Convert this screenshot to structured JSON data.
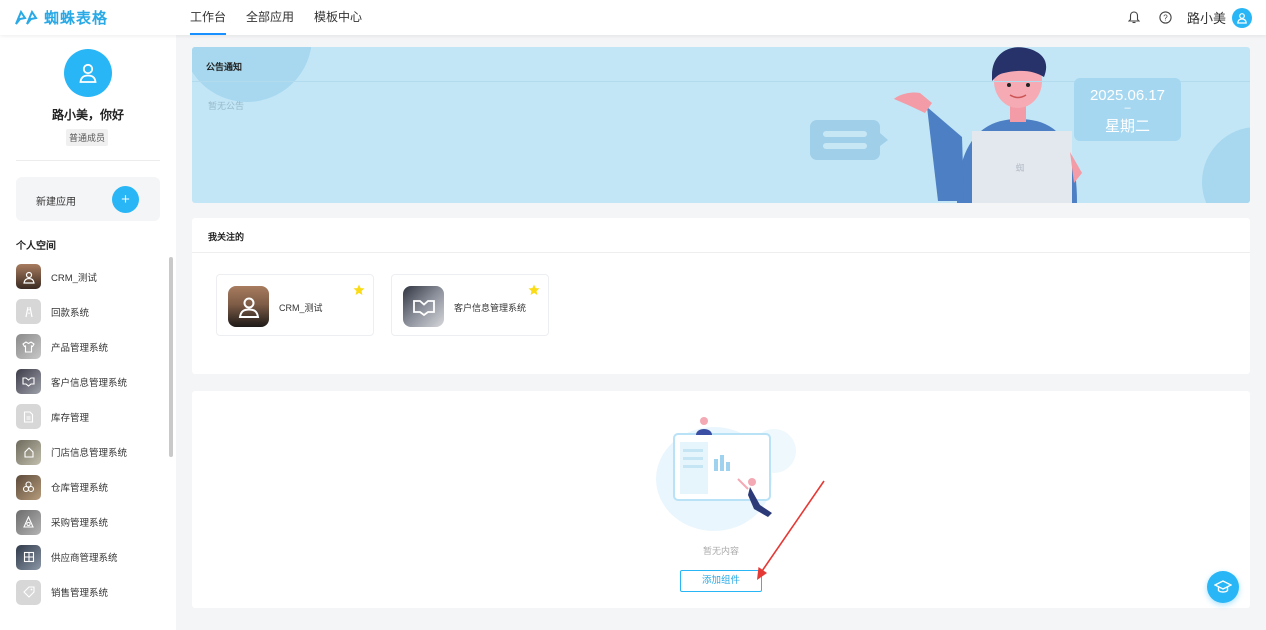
{
  "brand": {
    "name": "蜘蛛表格",
    "color": "#29a9e6"
  },
  "nav": {
    "items": [
      {
        "label": "工作台",
        "active": true
      },
      {
        "label": "全部应用",
        "active": false
      },
      {
        "label": "模板中心",
        "active": false
      }
    ]
  },
  "topbar": {
    "user_name": "路小美",
    "icons": [
      "bell-icon",
      "help-icon",
      "user-avatar-icon"
    ]
  },
  "sidebar": {
    "greeting": "路小美，你好",
    "role": "普通成员",
    "new_app_label": "新建应用",
    "new_app_button": "+",
    "section_title": "个人空间",
    "apps": [
      {
        "label": "CRM_测试"
      },
      {
        "label": "回款系统"
      },
      {
        "label": "产品管理系统"
      },
      {
        "label": "客户信息管理系统"
      },
      {
        "label": "库存管理"
      },
      {
        "label": "门店信息管理系统"
      },
      {
        "label": "仓库管理系统"
      },
      {
        "label": "采购管理系统"
      },
      {
        "label": "供应商管理系统"
      },
      {
        "label": "销售管理系统"
      }
    ]
  },
  "notice": {
    "title": "公告通知",
    "empty": "暂无公告",
    "date": "2025.06.17",
    "date_separator": "–",
    "weekday": "星期二"
  },
  "following": {
    "title": "我关注的",
    "items": [
      {
        "label": "CRM_测试"
      },
      {
        "label": "客户信息管理系统"
      }
    ]
  },
  "widgets": {
    "empty_text": "暂无内容",
    "add_button": "添加组件"
  },
  "colors": {
    "accent": "#29b6f6",
    "star": "#fadb14",
    "annotation_arrow": "#e53935"
  }
}
